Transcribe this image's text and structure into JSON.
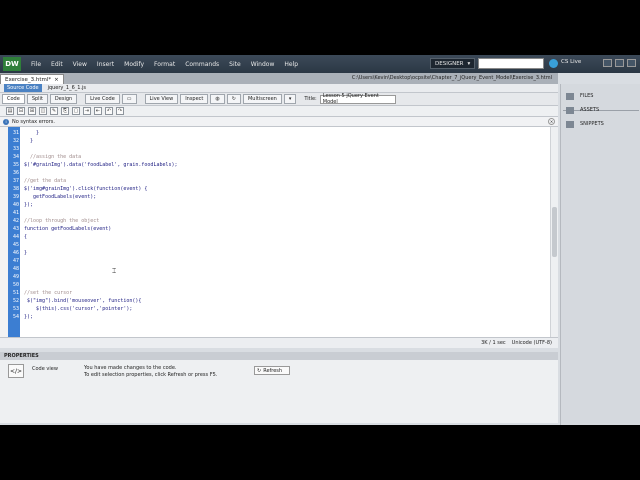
{
  "app": {
    "logo": "DW",
    "menu": [
      "File",
      "Edit",
      "View",
      "Insert",
      "Modify",
      "Format",
      "Commands",
      "Site",
      "Window",
      "Help"
    ],
    "workspace": "DESIGNER",
    "cs_live": "CS Live"
  },
  "tabs": {
    "active": "Exercise_3.html*",
    "close": "×",
    "path": "C:\\Users\\Kevin\\Desktop\\ocpsite\\Chapter_7_jQuery_Event_Model\\Exercise_3.html"
  },
  "related_files": {
    "source": "Source Code",
    "file1": "jquery_1_6_1.js"
  },
  "view": {
    "code": "Code",
    "split": "Split",
    "design": "Design",
    "live_code": "Live Code",
    "live_view": "Live View",
    "inspect": "Inspect",
    "multiscreen": "Multiscreen",
    "title_label": "Title:",
    "title_value": "Lesson 5 jQuery Event Model"
  },
  "syntax": {
    "message": "No syntax errors."
  },
  "code_lines": [
    {
      "num": "31",
      "text": "    }",
      "comment": false
    },
    {
      "num": "32",
      "text": "  }",
      "comment": false
    },
    {
      "num": "33",
      "text": "",
      "comment": false
    },
    {
      "num": "34",
      "text": "  //assign the data",
      "comment": true
    },
    {
      "num": "35",
      "text": "$('#grainImg').data('foodLabel', grain.foodLabels);",
      "comment": false
    },
    {
      "num": "36",
      "text": "",
      "comment": false
    },
    {
      "num": "37",
      "text": "//get the data",
      "comment": true
    },
    {
      "num": "38",
      "text": "$('img#grainImg').click(function(event) {",
      "comment": false
    },
    {
      "num": "39",
      "text": "   getFoodLabels(event);",
      "comment": false
    },
    {
      "num": "40",
      "text": "});",
      "comment": false
    },
    {
      "num": "41",
      "text": "",
      "comment": false
    },
    {
      "num": "42",
      "text": "//loop through the object",
      "comment": true
    },
    {
      "num": "43",
      "text": "function getFoodLabels(event)",
      "comment": false
    },
    {
      "num": "44",
      "text": "{",
      "comment": false
    },
    {
      "num": "45",
      "text": "",
      "comment": false
    },
    {
      "num": "46",
      "text": "}",
      "comment": false
    },
    {
      "num": "47",
      "text": "",
      "comment": false
    },
    {
      "num": "48",
      "text": "",
      "comment": false
    },
    {
      "num": "49",
      "text": "",
      "comment": false
    },
    {
      "num": "50",
      "text": "",
      "comment": false
    },
    {
      "num": "51",
      "text": "//set the cursor",
      "comment": true
    },
    {
      "num": "52",
      "text": " $(\"img\").bind('mouseover', function(){",
      "comment": false
    },
    {
      "num": "53",
      "text": "    $(this).css('cursor','pointer');",
      "comment": false
    },
    {
      "num": "54",
      "text": "});",
      "comment": false
    }
  ],
  "status": {
    "size": "3K / 1 sec",
    "encoding": "Unicode (UTF-8)"
  },
  "properties": {
    "header": "PROPERTIES",
    "label": "Code view",
    "msg1": "You have made changes to the code.",
    "msg2": "To edit selection properties, click Refresh or press F5.",
    "refresh": "Refresh"
  },
  "panel": {
    "files": "FILES",
    "assets": "ASSETS",
    "snippets": "SNIPPETS"
  }
}
